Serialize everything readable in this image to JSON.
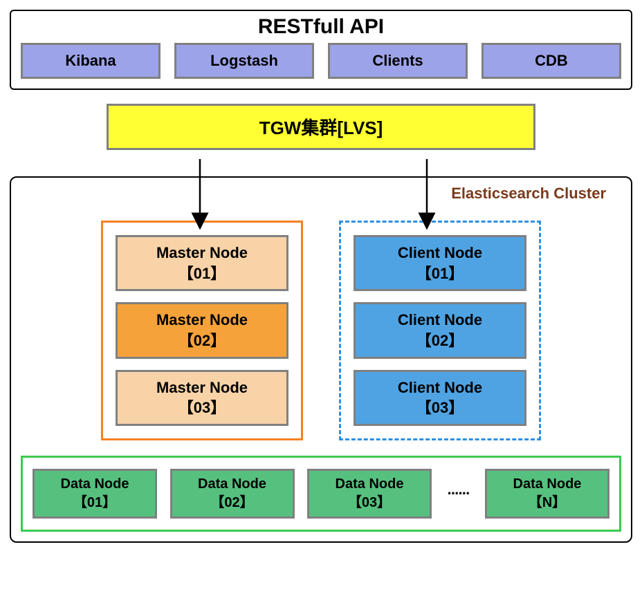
{
  "api": {
    "title": "RESTfull  API",
    "items": [
      "Kibana",
      "Logstash",
      "Clients",
      "CDB"
    ]
  },
  "tgw": {
    "label": "TGW集群[LVS]"
  },
  "cluster": {
    "label": "Elasticsearch Cluster",
    "master_nodes": [
      {
        "name": "Master Node",
        "id": "【01】",
        "active": false
      },
      {
        "name": "Master Node",
        "id": "【02】",
        "active": true
      },
      {
        "name": "Master Node",
        "id": "【03】",
        "active": false
      }
    ],
    "client_nodes": [
      {
        "name": "Client Node",
        "id": "【01】"
      },
      {
        "name": "Client Node",
        "id": "【02】"
      },
      {
        "name": "Client Node",
        "id": "【03】"
      }
    ],
    "data_nodes": [
      {
        "name": "Data Node",
        "id": "【01】"
      },
      {
        "name": "Data Node",
        "id": "【02】"
      },
      {
        "name": "Data Node",
        "id": "【03】"
      },
      {
        "name": "Data Node",
        "id": "【N】"
      }
    ],
    "ellipsis": "······"
  },
  "arrows": [
    {
      "from": "tgw",
      "to": "master-box"
    },
    {
      "from": "tgw",
      "to": "client-box"
    }
  ]
}
